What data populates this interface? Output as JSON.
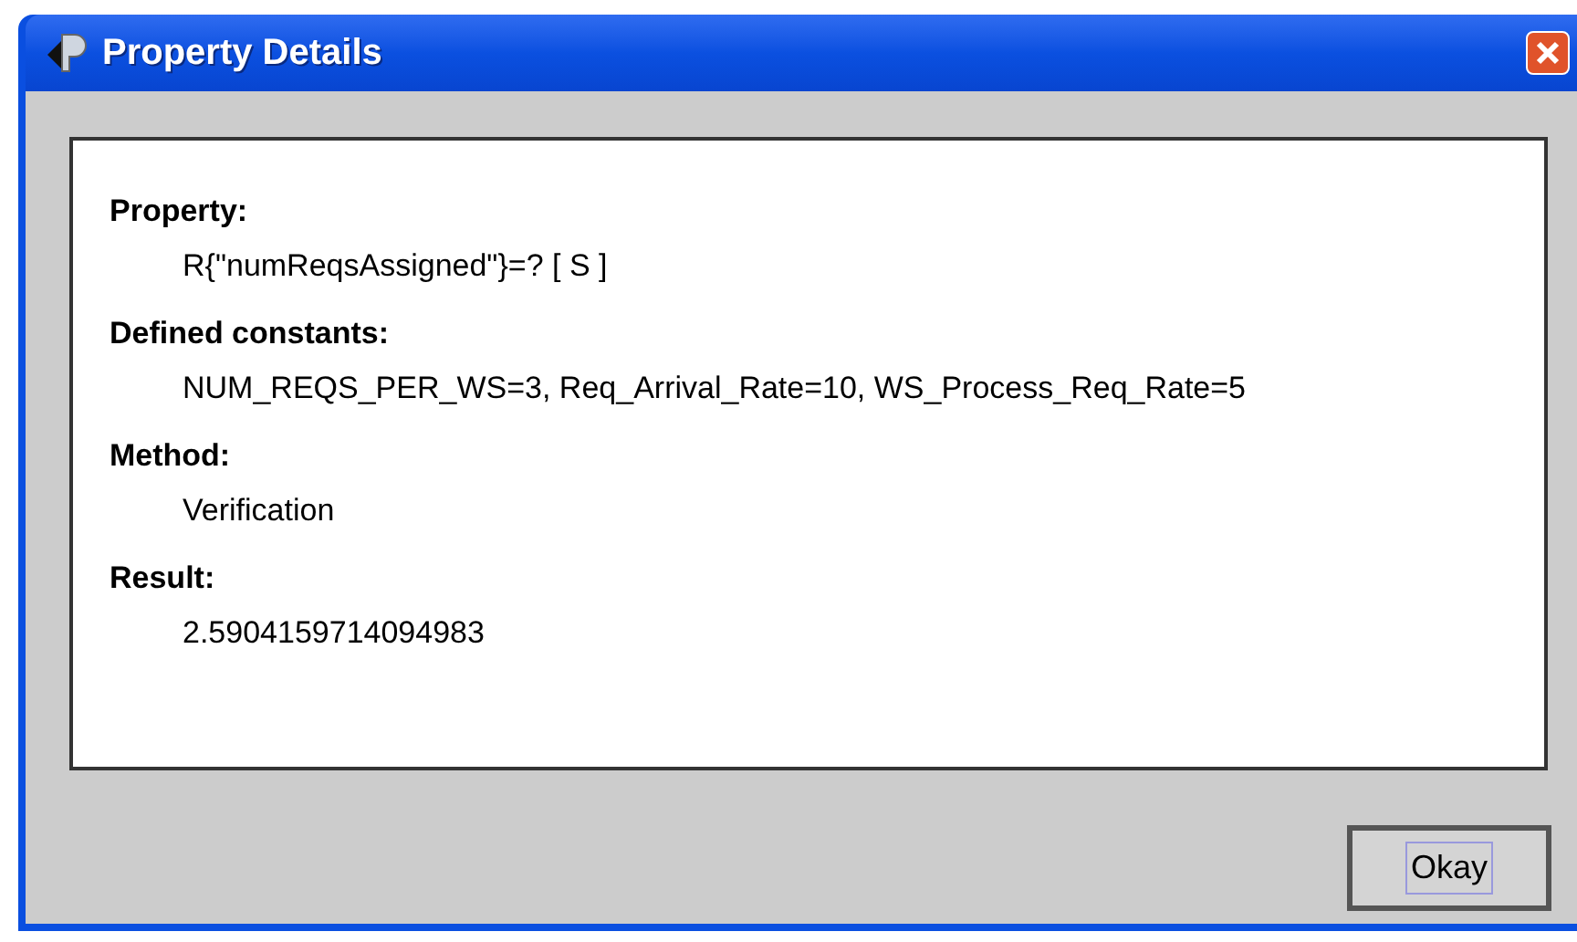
{
  "window": {
    "title": "Property Details"
  },
  "details": [
    {
      "label": "Property:",
      "value": "R{\"numReqsAssigned\"}=? [ S ]"
    },
    {
      "label": "Defined constants:",
      "value": "NUM_REQS_PER_WS=3, Req_Arrival_Rate=10, WS_Process_Req_Rate=5"
    },
    {
      "label": "Method:",
      "value": "Verification"
    },
    {
      "label": "Result:",
      "value": "2.5904159714094983"
    }
  ],
  "buttons": [
    {
      "label": "Okay",
      "focused": true
    }
  ]
}
